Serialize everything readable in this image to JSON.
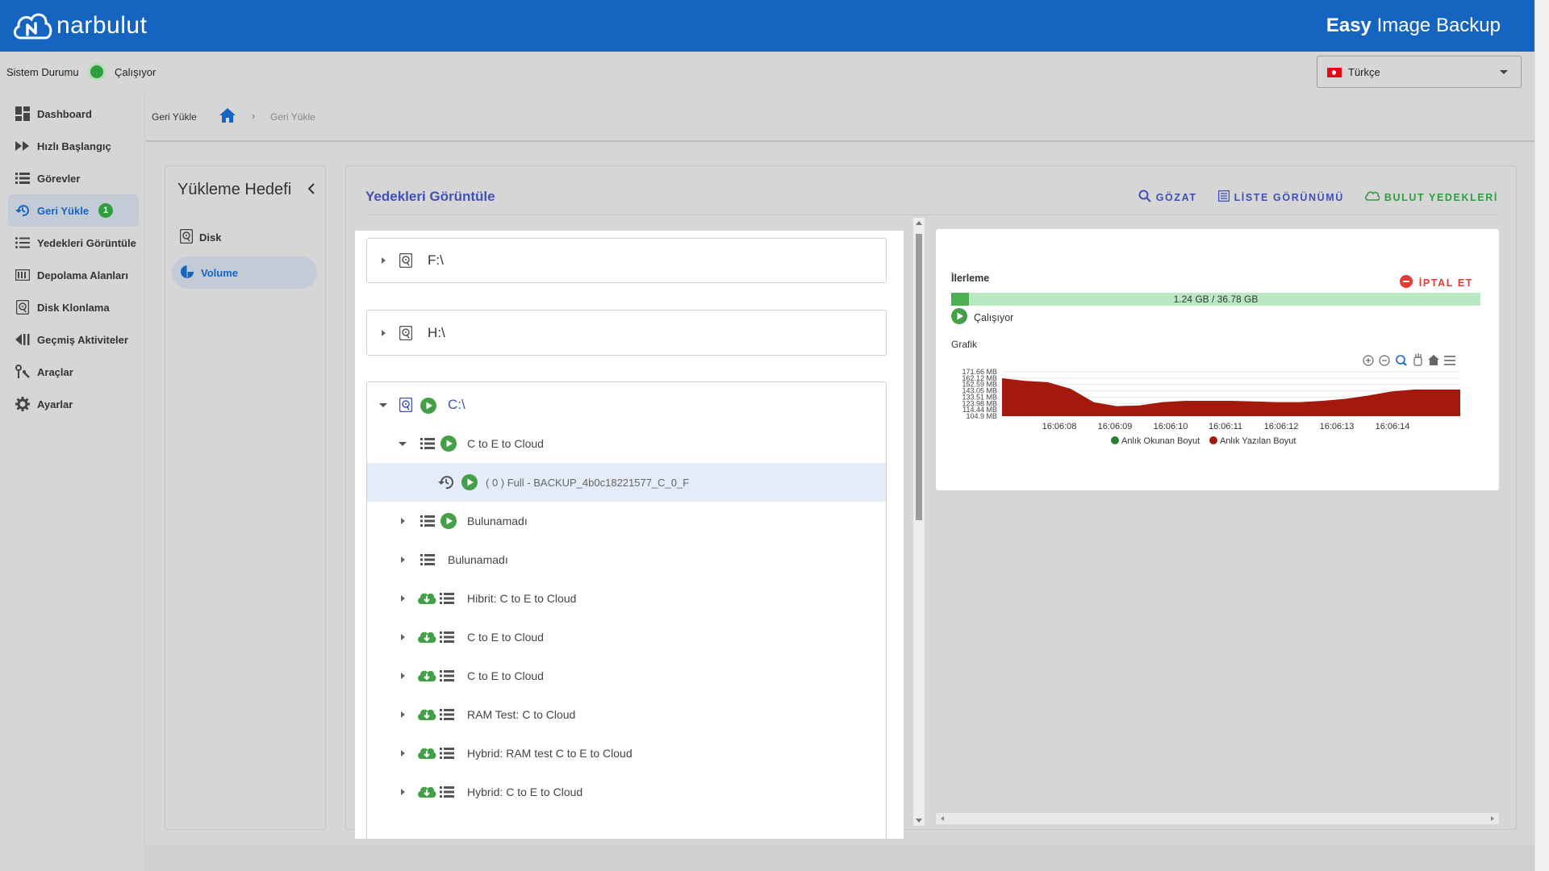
{
  "header": {
    "brand": "narbulut",
    "app_title_bold": "Easy",
    "app_title_rest": " Image Backup"
  },
  "status": {
    "label": "Sistem Durumu",
    "state": "Çalışıyor",
    "state_color": "#2e9e3e"
  },
  "language": {
    "selected": "Türkçe",
    "flag": "turkey-flag"
  },
  "sidebar": {
    "items": [
      {
        "label": "Dashboard",
        "icon": "dashboard-icon"
      },
      {
        "label": "Hızlı Başlangıç",
        "icon": "fast-forward-icon"
      },
      {
        "label": "Görevler",
        "icon": "list-icon"
      },
      {
        "label": "Geri Yükle",
        "icon": "restore-icon",
        "badge": "1",
        "active": true
      },
      {
        "label": "Yedekleri Görüntüle",
        "icon": "list-view-icon"
      },
      {
        "label": "Depolama Alanları",
        "icon": "storage-icon"
      },
      {
        "label": "Disk Klonlama",
        "icon": "disk-clone-icon"
      },
      {
        "label": "Geçmiş Aktiviteler",
        "icon": "history-icon"
      },
      {
        "label": "Araçlar",
        "icon": "tools-icon"
      },
      {
        "label": "Ayarlar",
        "icon": "gear-icon"
      }
    ]
  },
  "breadcrumb": {
    "root": "Geri Yükle",
    "sep": "›",
    "current": "Geri Yükle"
  },
  "target": {
    "title": "Yükleme Hedefi",
    "items": [
      {
        "label": "Disk",
        "icon": "disk-icon"
      },
      {
        "label": "Volume",
        "icon": "volume-pie-icon",
        "selected": true
      }
    ]
  },
  "main": {
    "title": "Yedekleri Görüntüle",
    "actions": {
      "browse": "GÖZAT",
      "list_view": "LİSTE GÖRÜNÜMÜ",
      "cloud_backups": "BULUT YEDEKLERİ"
    }
  },
  "tree": {
    "drives": [
      {
        "label": "F:\\"
      },
      {
        "label": "H:\\"
      },
      {
        "label": "C:\\"
      }
    ],
    "c_rows": [
      {
        "label": "C to E to Cloud",
        "expanded": true
      },
      {
        "label": "( 0 ) Full - BACKUP_4b0c18221577_C_0_F"
      },
      {
        "label": "Bulunamadı"
      },
      {
        "label": "Bulunamadı"
      },
      {
        "label": "Hibrit: C to E to Cloud"
      },
      {
        "label": "C to E to Cloud"
      },
      {
        "label": "C to E to Cloud"
      },
      {
        "label": "RAM Test: C to Cloud"
      },
      {
        "label": "Hybrid: RAM test C to E to Cloud"
      },
      {
        "label": "Hybrid: C to E to Cloud"
      }
    ]
  },
  "progress": {
    "label": "İlerleme",
    "cancel": "İPTAL ET",
    "text": "1.24 GB / 36.78 GB",
    "fraction": 0.0337,
    "status": "Çalışıyor",
    "chart_label": "Grafik"
  },
  "chart_data": {
    "type": "area",
    "x": [
      "16:06:08",
      "16:06:09",
      "16:06:10",
      "16:06:11",
      "16:06:12",
      "16:06:13",
      "16:06:14"
    ],
    "y_ticks": [
      "171.66 MB",
      "162.12 MB",
      "152.59 MB",
      "143.05 MB",
      "133.51 MB",
      "123.98 MB",
      "114.44 MB",
      "104.9 MB"
    ],
    "ylim": [
      104.9,
      171.66
    ],
    "series": [
      {
        "name": "Anlık Okunan Boyut",
        "color": "#2e7d32",
        "values": []
      },
      {
        "name": "Anlık Yazılan Boyut",
        "color": "#a31a0d",
        "values": [
          162,
          158,
          156,
          146,
          126,
          120,
          121,
          126,
          128,
          128,
          128,
          127,
          126,
          126,
          128,
          131,
          136,
          142,
          145,
          145,
          145
        ]
      }
    ],
    "grid": true,
    "legend": "bottom"
  }
}
